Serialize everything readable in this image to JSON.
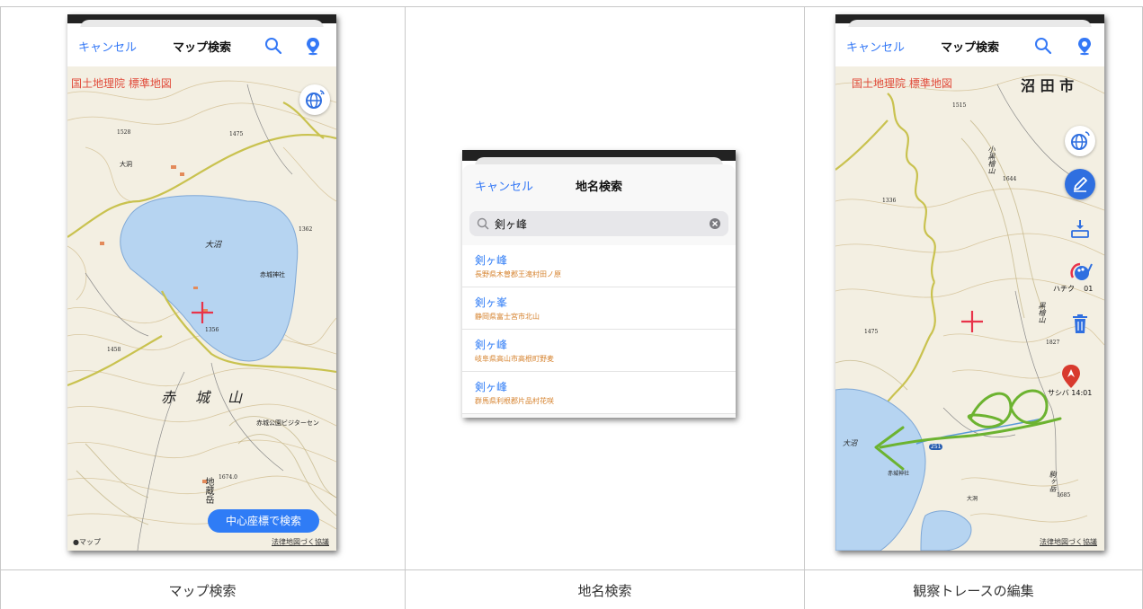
{
  "captions": [
    "マップ検索",
    "地名検索",
    "観察トレースの編集"
  ],
  "panel1": {
    "cancel": "キャンセル",
    "title": "マップ検索",
    "map_source": "国土地理院 標準地図",
    "search_center_button": "中心座標で検索",
    "map_labels": {
      "lake": "大沼",
      "shrine": "赤城神社",
      "mountain_a": "赤",
      "mountain_b": "城",
      "mountain_c": "山",
      "visitor": "赤城公園ビジターセン",
      "jizo": "地蔵岳",
      "ohora": "大洞",
      "e1": "1528",
      "e2": "1362",
      "e3": "1356",
      "e4": "1458",
      "e5": "1475",
      "e6": "1674.0"
    },
    "apple_maps": "マップ",
    "attribution": "法律地図づく協議"
  },
  "panel2": {
    "cancel": "キャンセル",
    "title": "地名検索",
    "query": "剣ヶ峰",
    "results": [
      {
        "name": "剣ヶ峰",
        "address": "長野県木曽郡王滝村田ノ原"
      },
      {
        "name": "剣ヶ峯",
        "address": "静岡県富士宮市北山"
      },
      {
        "name": "剣ヶ峰",
        "address": "岐阜県高山市高根町野麦"
      },
      {
        "name": "剣ヶ峰",
        "address": "群馬県利根郡片品村花咲"
      }
    ]
  },
  "panel3": {
    "cancel": "キャンセル",
    "title": "マップ検索",
    "map_source": "国土地理院 標準地図",
    "city": "沼 田 市",
    "palette_label": "ハチク",
    "palette_suffix": "01",
    "marker_label": "サシバ 14:01",
    "map_labels": {
      "koguro": "小黒檜山",
      "kuro": "黒檜山",
      "koma": "駒ヶ岳",
      "lake": "大沼",
      "shrine": "赤城神社",
      "route": "251",
      "ohora": "大洞",
      "e1": "1515",
      "e2": "1644",
      "e3": "1336",
      "e4": "1475",
      "e5": "1827",
      "e6": "1685"
    },
    "attribution": "法律地図づく協議"
  },
  "colors": {
    "accent": "#2f7cf6",
    "map_source_red": "#e14b3b",
    "crosshair": "#e8334a",
    "trace_green": "#6cb330",
    "lake": "#b6d4f1"
  }
}
